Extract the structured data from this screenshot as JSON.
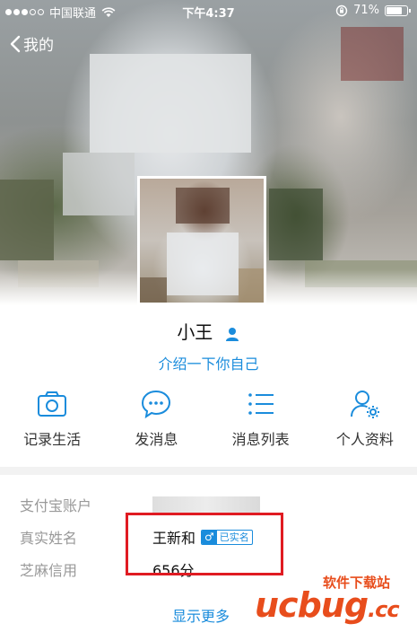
{
  "status_bar": {
    "carrier": "中国联通",
    "time": "下午4:37",
    "battery": "71%",
    "battery_level": 0.71
  },
  "nav": {
    "back_label": "我的"
  },
  "profile": {
    "name": "小王",
    "intro_link": "介绍一下你自己"
  },
  "actions": [
    {
      "label": "记录生活",
      "icon": "camera-icon"
    },
    {
      "label": "发消息",
      "icon": "chat-bubble-icon"
    },
    {
      "label": "消息列表",
      "icon": "list-icon"
    },
    {
      "label": "个人资料",
      "icon": "user-settings-icon"
    }
  ],
  "info": {
    "alipay_label": "支付宝账户",
    "realname_label": "真实姓名",
    "realname_value": "王新和",
    "gender_symbol": "♂",
    "verified_badge": "已实名",
    "credit_label": "芝麻信用",
    "credit_value": "656分"
  },
  "show_more": "显示更多",
  "watermark": {
    "text": "软件下载站",
    "logo_main": "ucbug",
    "logo_suffix": ".cc"
  },
  "colors": {
    "accent": "#1a8cdc",
    "highlight": "#e01b22",
    "watermark_orange": "#e84d1c",
    "watermark_blue": "#2d6fcf"
  }
}
